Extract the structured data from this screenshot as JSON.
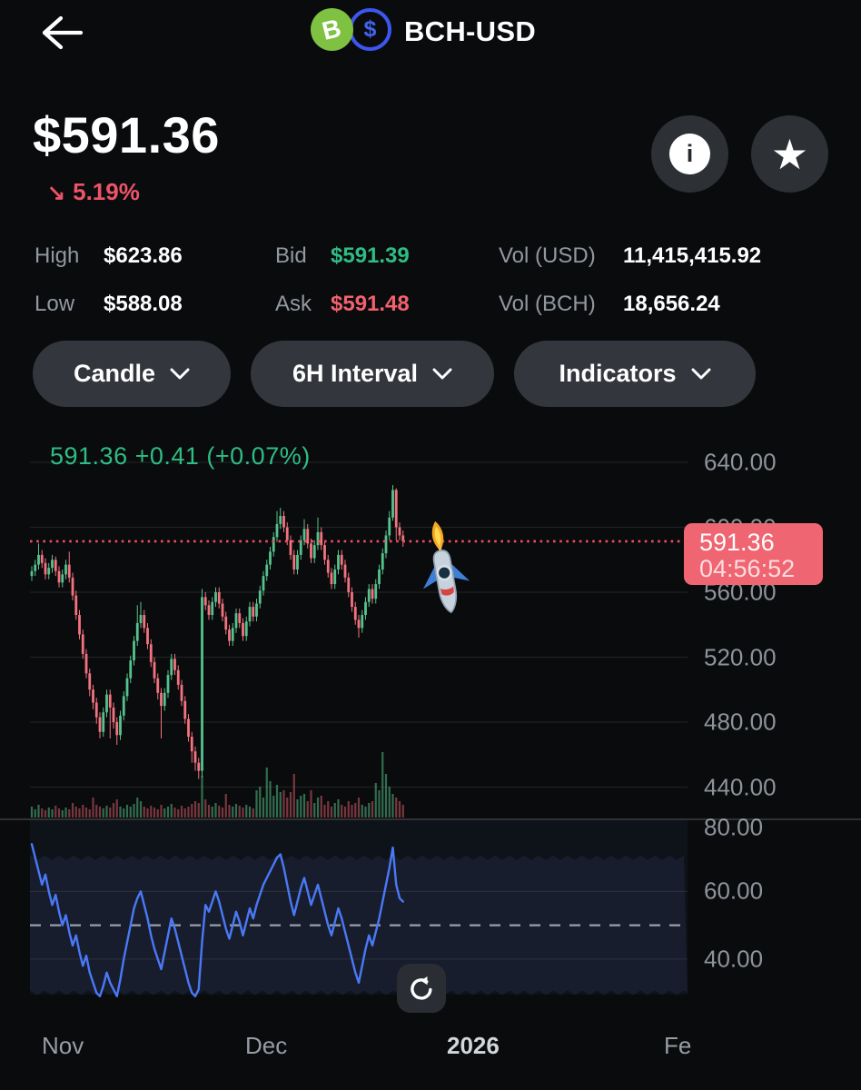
{
  "header": {
    "title": "BCH-USD",
    "back_label": "back"
  },
  "price": {
    "value": "$591.36",
    "change": "5.19%",
    "direction": "down",
    "down_arrow": "↘"
  },
  "stats": {
    "high_label": "High",
    "high_value": "$623.86",
    "low_label": "Low",
    "low_value": "$588.08",
    "bid_label": "Bid",
    "bid_value": "$591.39",
    "ask_label": "Ask",
    "ask_value": "$591.48",
    "vol_usd_label": "Vol (USD)",
    "vol_usd_value": "11,415,415.92",
    "vol_bch_label": "Vol (BCH)",
    "vol_bch_value": "18,656.24"
  },
  "controls": {
    "candle_label": "Candle",
    "interval_label": "6H Interval",
    "indicators_label": "Indicators"
  },
  "chart_label": "591.36  +0.41 (+0.07%)",
  "price_tag": {
    "price": "591.36",
    "time": "04:56:52"
  },
  "icons": {
    "info": "i",
    "star": "★",
    "coin_b": "B",
    "coin_usd": "$"
  },
  "colors": {
    "accent_green": "#2ebd85",
    "accent_red": "#ec5468",
    "candle_up": "#56c28d",
    "candle_down": "#f3737f",
    "volume_up": "rgba(76,175,125,0.6)",
    "volume_down": "rgba(214,92,103,0.55)",
    "rsi_line": "#4a79f7",
    "tag_bg": "#ef6571",
    "dotted_line": "#ef4f64"
  },
  "chart_data": {
    "type": "candlestick",
    "interval": "6H",
    "last_price": 591.36,
    "price_axis": {
      "ticks": [
        640,
        600,
        560,
        520,
        480,
        440
      ],
      "labels": [
        "640.00",
        "600.00",
        "560.00",
        "520.00",
        "480.00",
        "440.00"
      ]
    },
    "rsi_axis": {
      "ticks": [
        80,
        60,
        40
      ],
      "labels": [
        "80.00",
        "60.00",
        "40.00"
      ],
      "dashed_at": 50,
      "band": [
        30,
        70
      ]
    },
    "x_axis": {
      "labels": [
        "Nov",
        "Dec",
        "2026",
        "Fe"
      ],
      "positions": [
        46,
        270,
        492,
        731
      ],
      "bold_label": "2026"
    },
    "candles": [
      [
        570,
        576,
        567,
        573
      ],
      [
        573,
        580,
        570,
        577
      ],
      [
        577,
        590,
        574,
        583
      ],
      [
        583,
        586,
        575,
        578
      ],
      [
        578,
        581,
        568,
        571
      ],
      [
        571,
        578,
        568,
        575
      ],
      [
        575,
        583,
        572,
        580
      ],
      [
        580,
        582,
        570,
        573
      ],
      [
        573,
        576,
        563,
        566
      ],
      [
        566,
        574,
        563,
        571
      ],
      [
        571,
        580,
        568,
        577
      ],
      [
        577,
        585,
        566,
        569
      ],
      [
        569,
        572,
        555,
        558
      ],
      [
        558,
        561,
        543,
        546
      ],
      [
        546,
        549,
        531,
        534
      ],
      [
        534,
        537,
        519,
        522
      ],
      [
        522,
        525,
        507,
        510
      ],
      [
        510,
        513,
        496,
        500
      ],
      [
        500,
        503,
        488,
        492
      ],
      [
        492,
        495,
        479,
        483
      ],
      [
        483,
        486,
        470,
        474
      ],
      [
        474,
        489,
        471,
        486
      ],
      [
        486,
        500,
        483,
        497
      ],
      [
        497,
        500,
        470,
        489
      ],
      [
        489,
        492,
        476,
        480
      ],
      [
        480,
        483,
        466,
        472
      ],
      [
        472,
        487,
        469,
        484
      ],
      [
        484,
        499,
        481,
        496
      ],
      [
        496,
        510,
        493,
        507
      ],
      [
        507,
        521,
        504,
        518
      ],
      [
        518,
        533,
        515,
        530
      ],
      [
        530,
        552,
        527,
        541
      ],
      [
        541,
        554,
        538,
        546
      ],
      [
        546,
        549,
        535,
        538
      ],
      [
        538,
        541,
        525,
        528
      ],
      [
        528,
        531,
        514,
        517
      ],
      [
        517,
        520,
        504,
        507
      ],
      [
        507,
        510,
        494,
        498
      ],
      [
        498,
        501,
        470,
        490
      ],
      [
        490,
        501,
        487,
        498
      ],
      [
        498,
        512,
        495,
        509
      ],
      [
        509,
        522,
        506,
        519
      ],
      [
        519,
        522,
        509,
        512
      ],
      [
        512,
        515,
        500,
        503
      ],
      [
        503,
        506,
        490,
        493
      ],
      [
        493,
        496,
        479,
        482
      ],
      [
        482,
        485,
        468,
        471
      ],
      [
        471,
        474,
        455,
        462
      ],
      [
        462,
        465,
        450,
        455
      ],
      [
        455,
        458,
        445,
        450
      ],
      [
        450,
        562,
        446,
        557
      ],
      [
        557,
        560,
        549,
        552
      ],
      [
        552,
        555,
        543,
        546
      ],
      [
        546,
        557,
        543,
        554
      ],
      [
        554,
        563,
        551,
        560
      ],
      [
        560,
        563,
        550,
        553
      ],
      [
        553,
        556,
        542,
        545
      ],
      [
        545,
        548,
        534,
        537
      ],
      [
        537,
        540,
        527,
        530
      ],
      [
        530,
        541,
        527,
        538
      ],
      [
        538,
        550,
        535,
        547
      ],
      [
        547,
        550,
        538,
        541
      ],
      [
        541,
        544,
        530,
        533
      ],
      [
        533,
        545,
        530,
        542
      ],
      [
        542,
        554,
        539,
        551
      ],
      [
        551,
        554,
        542,
        545
      ],
      [
        545,
        556,
        542,
        553
      ],
      [
        553,
        564,
        550,
        561
      ],
      [
        561,
        573,
        558,
        570
      ],
      [
        570,
        580,
        567,
        577
      ],
      [
        577,
        588,
        574,
        585
      ],
      [
        585,
        597,
        582,
        594
      ],
      [
        594,
        610,
        591,
        602
      ],
      [
        602,
        612,
        599,
        607
      ],
      [
        607,
        610,
        597,
        600
      ],
      [
        600,
        603,
        589,
        592
      ],
      [
        592,
        595,
        580,
        583
      ],
      [
        583,
        586,
        571,
        574
      ],
      [
        574,
        586,
        571,
        583
      ],
      [
        583,
        595,
        580,
        592
      ],
      [
        592,
        605,
        589,
        599
      ],
      [
        599,
        602,
        587,
        590
      ],
      [
        590,
        593,
        578,
        581
      ],
      [
        581,
        592,
        578,
        589
      ],
      [
        589,
        606,
        586,
        597
      ],
      [
        597,
        600,
        586,
        589
      ],
      [
        589,
        592,
        577,
        580
      ],
      [
        580,
        583,
        569,
        572
      ],
      [
        572,
        575,
        562,
        565
      ],
      [
        565,
        577,
        562,
        574
      ],
      [
        574,
        586,
        571,
        583
      ],
      [
        583,
        586,
        574,
        577
      ],
      [
        577,
        580,
        566,
        569
      ],
      [
        569,
        572,
        557,
        560
      ],
      [
        560,
        563,
        548,
        551
      ],
      [
        551,
        554,
        540,
        543
      ],
      [
        543,
        546,
        532,
        538
      ],
      [
        538,
        549,
        535,
        546
      ],
      [
        546,
        557,
        543,
        554
      ],
      [
        554,
        565,
        551,
        562
      ],
      [
        562,
        565,
        553,
        556
      ],
      [
        556,
        568,
        553,
        565
      ],
      [
        565,
        577,
        562,
        574
      ],
      [
        574,
        587,
        571,
        584
      ],
      [
        584,
        598,
        581,
        595
      ],
      [
        595,
        610,
        592,
        606
      ],
      [
        606,
        626,
        604,
        623
      ],
      [
        623,
        624,
        592,
        600
      ],
      [
        600,
        603,
        592,
        595
      ],
      [
        595,
        598,
        588,
        591.36
      ]
    ],
    "volume": [
      12,
      9,
      14,
      10,
      8,
      11,
      9,
      13,
      10,
      8,
      11,
      9,
      16,
      12,
      10,
      14,
      11,
      9,
      22,
      14,
      12,
      10,
      13,
      11,
      16,
      20,
      12,
      10,
      14,
      12,
      15,
      22,
      18,
      12,
      10,
      13,
      11,
      9,
      14,
      10,
      12,
      15,
      11,
      9,
      13,
      10,
      12,
      15,
      18,
      16,
      46,
      20,
      14,
      12,
      16,
      13,
      11,
      26,
      14,
      12,
      15,
      13,
      11,
      14,
      12,
      10,
      30,
      34,
      22,
      55,
      40,
      24,
      36,
      28,
      30,
      22,
      28,
      48,
      20,
      24,
      26,
      18,
      30,
      16,
      22,
      24,
      14,
      18,
      12,
      16,
      20,
      14,
      12,
      18,
      14,
      16,
      22,
      14,
      12,
      16,
      18,
      38,
      30,
      72,
      48,
      34,
      26,
      22,
      18,
      14
    ],
    "rsi": [
      74,
      70,
      66,
      62,
      65,
      60,
      56,
      59,
      54,
      50,
      53,
      48,
      44,
      47,
      42,
      38,
      41,
      36,
      33,
      30,
      29,
      32,
      36,
      33,
      31,
      29,
      34,
      40,
      45,
      50,
      55,
      58,
      60,
      56,
      52,
      47,
      43,
      40,
      37,
      42,
      47,
      52,
      49,
      45,
      41,
      37,
      33,
      30,
      29,
      31,
      45,
      56,
      54,
      57,
      60,
      57,
      53,
      49,
      46,
      50,
      54,
      51,
      47,
      51,
      55,
      52,
      56,
      59,
      62,
      64,
      66,
      68,
      70,
      71,
      67,
      62,
      57,
      53,
      57,
      61,
      64,
      60,
      56,
      59,
      62,
      58,
      54,
      50,
      47,
      51,
      55,
      52,
      48,
      44,
      40,
      36,
      33,
      38,
      43,
      47,
      44,
      48,
      52,
      57,
      62,
      67,
      73,
      62,
      58,
      57
    ]
  }
}
